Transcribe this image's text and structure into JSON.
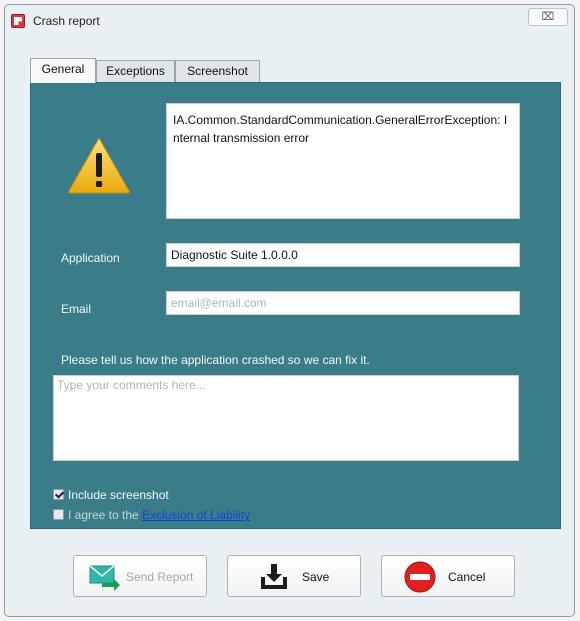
{
  "window": {
    "title": "Crash report",
    "close_glyph": "⌧"
  },
  "tabs": [
    {
      "label": "General",
      "active": true
    },
    {
      "label": "Exceptions",
      "active": false
    },
    {
      "label": "Screenshot",
      "active": false
    }
  ],
  "general": {
    "error_text": "IA.Common.StandardCommunication.GeneralErrorException: Internal transmission error",
    "application_label": "Application",
    "application_value": "Diagnostic Suite 1.0.0.0",
    "email_label": "Email",
    "email_placeholder": "email@email.com",
    "comments_prompt": "Please tell us how the application crashed so we can fix it.",
    "comments_placeholder": "Type your comments here...",
    "include_screenshot_label": "Include screenshot",
    "include_screenshot_checked": true,
    "agree_label": "I agree to the",
    "agree_link": "Exclusion of Liability",
    "agree_checked": false
  },
  "buttons": {
    "send_label": "Send Report",
    "send_enabled": false,
    "save_label": "Save",
    "cancel_label": "Cancel"
  },
  "colors": {
    "panel_bg": "#3a7d89",
    "link": "#1a3fd8",
    "warning": "#f3c21c",
    "cancel_red": "#e02020"
  },
  "icons": {
    "app": "crash-report-app-icon",
    "warning": "warning-triangle-icon",
    "send": "envelope-arrow-icon",
    "save": "download-save-icon",
    "cancel": "no-entry-icon"
  }
}
